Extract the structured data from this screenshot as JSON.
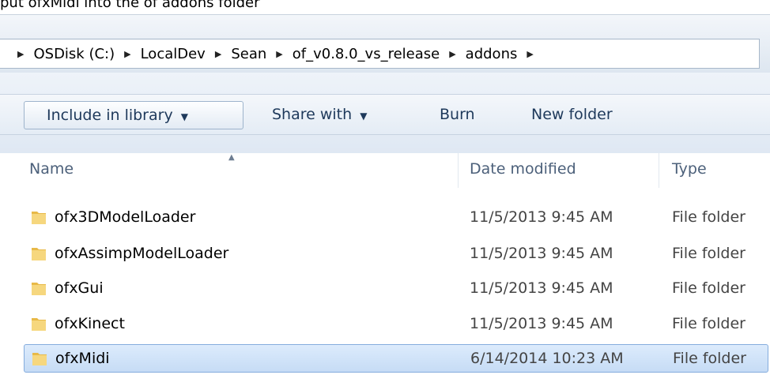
{
  "caption": "put ofxMidi into the of addons folder",
  "breadcrumb": [
    "OSDisk (C:)",
    "LocalDev",
    "Sean",
    "of_v0.8.0_vs_release",
    "addons"
  ],
  "toolbar": {
    "include_label": "Include in library",
    "share_label": "Share with",
    "burn_label": "Burn",
    "new_folder_label": "New folder"
  },
  "columns": {
    "name": "Name",
    "date": "Date modified",
    "type": "Type"
  },
  "files": [
    {
      "name": "ofx3DModelLoader",
      "date": "11/5/2013 9:45 AM",
      "type": "File folder"
    },
    {
      "name": "ofxAssimpModelLoader",
      "date": "11/5/2013 9:45 AM",
      "type": "File folder"
    },
    {
      "name": "ofxGui",
      "date": "11/5/2013 9:45 AM",
      "type": "File folder"
    },
    {
      "name": "ofxKinect",
      "date": "11/5/2013 9:45 AM",
      "type": "File folder"
    },
    {
      "name": "ofxMidi",
      "date": "6/14/2014 10:23 AM",
      "type": "File folder"
    }
  ]
}
